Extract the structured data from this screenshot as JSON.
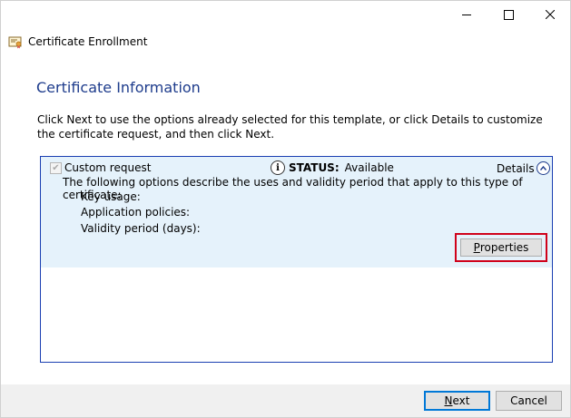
{
  "window": {
    "controls": {
      "minimize": "minimize-icon",
      "maximize": "maximize-icon",
      "close": "close-icon"
    }
  },
  "app": {
    "title": "Certificate Enrollment",
    "icon": "certificate-icon"
  },
  "page": {
    "title": "Certificate Information",
    "instructions": "Click Next to use the options already selected for this template, or click Details to customize the certificate request, and then click Next."
  },
  "request": {
    "checked": true,
    "name": "Custom request",
    "status_label": "STATUS:",
    "status_value": "Available",
    "details_label": "Details",
    "description": "The following options describe the uses and validity period that apply to this type of certificate:",
    "properties": [
      {
        "label": "Key usage:"
      },
      {
        "label": "Application policies:"
      },
      {
        "label": "Validity period (days):"
      }
    ],
    "properties_button": {
      "underlined": "P",
      "rest": "roperties"
    }
  },
  "footer": {
    "next_button": {
      "underlined": "N",
      "rest": "ext"
    },
    "cancel_button": "Cancel"
  },
  "colors": {
    "accent": "#1e3c8c",
    "selection_bg": "#e5f2fb",
    "highlight": "#d0021b",
    "focus": "#0078d7"
  }
}
